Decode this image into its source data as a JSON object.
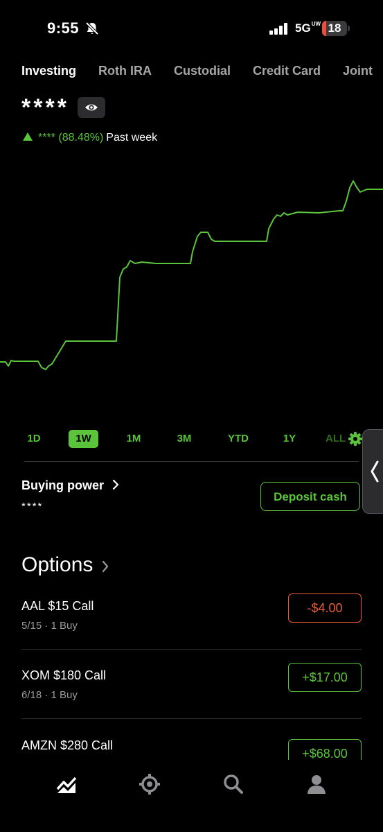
{
  "status": {
    "time": "9:55",
    "network": "5G",
    "network_badge": "UW",
    "battery": "18",
    "battery_color": "#eb4e3d"
  },
  "tabs": [
    {
      "label": "Investing",
      "active": true
    },
    {
      "label": "Roth IRA",
      "active": false
    },
    {
      "label": "Custodial",
      "active": false
    },
    {
      "label": "Credit Card",
      "active": false
    },
    {
      "label": "Joint",
      "active": false
    }
  ],
  "portfolio": {
    "value": "****",
    "change_value": "****",
    "change_percent": "(88.48%)",
    "period": "Past week",
    "icons": {
      "visibility": "eye-icon",
      "up": "triangle-up-icon"
    }
  },
  "chart_data": {
    "type": "line",
    "title": "",
    "xlabel": "",
    "ylabel": "",
    "color": "#5ac53b",
    "x": [
      0,
      8,
      12,
      16,
      20,
      55,
      60,
      66,
      70,
      75,
      95,
      100,
      168,
      173,
      178,
      183,
      188,
      195,
      205,
      225,
      250,
      275,
      278,
      285,
      290,
      300,
      305,
      310,
      320,
      330,
      360,
      385,
      388,
      395,
      400,
      405,
      410,
      415,
      430,
      460,
      490,
      495,
      500,
      505,
      510,
      515,
      520,
      530,
      553
    ],
    "values": [
      88,
      88,
      82,
      90,
      89,
      89,
      80,
      77,
      82,
      85,
      118,
      118,
      118,
      210,
      222,
      225,
      234,
      230,
      232,
      230,
      230,
      230,
      247,
      269,
      275,
      275,
      265,
      262,
      262,
      262,
      262,
      262,
      280,
      294,
      300,
      298,
      303,
      300,
      304,
      303,
      306,
      306,
      320,
      339,
      349,
      340,
      333,
      337,
      337
    ],
    "ylim": [
      0,
      350
    ]
  },
  "ranges": {
    "items": [
      "1D",
      "1W",
      "1M",
      "3M",
      "YTD",
      "1Y",
      "ALL"
    ],
    "active": "1W"
  },
  "buying_power": {
    "label": "Buying power",
    "value": "****",
    "deposit_label": "Deposit cash"
  },
  "options": {
    "title": "Options",
    "rows": [
      {
        "name": "AAL $15 Call",
        "detail": "5/15 · 1 Buy",
        "pl": "-$4.00",
        "positive": false
      },
      {
        "name": "XOM $180 Call",
        "detail": "6/18 · 1 Buy",
        "pl": "+$17.00",
        "positive": true
      },
      {
        "name": "AMZN $280 Call",
        "detail": "",
        "pl": "+$68.00",
        "positive": true
      }
    ]
  },
  "nav": {
    "items": [
      "chart-icon",
      "crypto-icon",
      "search-icon",
      "account-icon"
    ]
  },
  "colors": {
    "gain": "#5ac53b",
    "loss": "#eb5d36",
    "background": "#000000"
  }
}
